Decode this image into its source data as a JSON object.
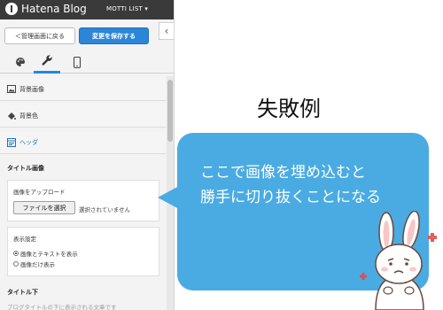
{
  "app": {
    "logo_text": "Hatena Blog",
    "blog_switch": "MOTTI LIST ▾"
  },
  "toolbar": {
    "back_label": "＜管理画面に戻る",
    "save_label": "変更を保存する",
    "collapse_label": "‹"
  },
  "tabs": [
    {
      "name": "design",
      "icon": "palette-icon"
    },
    {
      "name": "customize",
      "icon": "wrench-icon",
      "active": true
    },
    {
      "name": "mobile",
      "icon": "smartphone-icon"
    }
  ],
  "sections": [
    {
      "label": "背景画像",
      "icon": "image-icon"
    },
    {
      "label": "背景色",
      "icon": "paint-bucket-icon"
    },
    {
      "label": "ヘッダ",
      "icon": "header-icon",
      "expanded": true
    }
  ],
  "header_section": {
    "title_image_heading": "タイトル画像",
    "upload_label": "画像をアップロード",
    "file_button_label": "ファイルを選択",
    "file_status": "選択されていません",
    "display_setting_label": "表示設定",
    "options": [
      {
        "label": "画像とテキストを表示",
        "selected": true
      },
      {
        "label": "画像だけ表示",
        "selected": false
      }
    ],
    "title_below_heading": "タイトル下",
    "faded_text": "ブログタイトルの下に表示される文章です"
  },
  "annotation": {
    "title": "失敗例",
    "bubble_lines": [
      "ここで画像を埋め込むと",
      "勝手に切り抜くことになる"
    ],
    "bubble_color": "#4aabe3"
  },
  "colors": {
    "topbar": "#3a3a3a",
    "accent": "#2c86d8",
    "active_tab": "#1e88e5"
  }
}
